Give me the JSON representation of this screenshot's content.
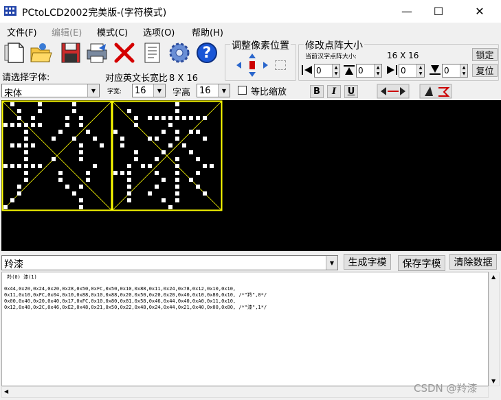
{
  "window": {
    "title": "PCtoLCD2002完美版-(字符模式)",
    "minimize_glyph": "—",
    "maximize_glyph": "☐",
    "close_glyph": "✕"
  },
  "menu": {
    "items": [
      {
        "label": "文件(F)"
      },
      {
        "label": "编辑(E)"
      },
      {
        "label": "模式(C)"
      },
      {
        "label": "选项(O)"
      },
      {
        "label": "帮助(H)"
      }
    ]
  },
  "toolbar": {
    "icons": [
      "new-icon",
      "open-icon",
      "save-icon",
      "print-icon",
      "delete-icon",
      "notes-icon",
      "settings-gear-icon",
      "help-icon"
    ],
    "help_glyph": "?"
  },
  "font_panel": {
    "choose_font_label": "请选择字体:",
    "font_value": "宋体",
    "ratio_label": "对应英文长宽比",
    "ratio_value": "8 X 16",
    "width_label": "字宽:",
    "width_value": "16",
    "height_label": "字高",
    "height_value": "16",
    "keep_ratio_label": "等比缩放",
    "bold_label": "B",
    "italic_label": "I",
    "underline_label": "U"
  },
  "adjust_group": {
    "title": "调整像素位置"
  },
  "matrix_group": {
    "title": "修改点阵大小",
    "current_label": "当前汉字点阵大小:",
    "current_value": "16 X 16",
    "lock_label": "锁定",
    "reset_label": "复位",
    "spinners": [
      "0",
      "0",
      "0",
      "0"
    ]
  },
  "input_row": {
    "text_value": "羚漆",
    "generate_label": "生成字模",
    "save_label": "保存字模",
    "clear_label": "清除数据"
  },
  "output": {
    "header": " 羚(0) 漆(1)",
    "lines": [
      "0x44,0x20,0x24,0x20,0x28,0x50,0xFC,0x50,0x10,0x88,0x11,0x24,0x78,0x12,0x10,0x10,",
      "0x11,0x10,0xFC,0x04,0x10,0x88,0x10,0x88,0x20,0x50,0x20,0x20,0x40,0x10,0x80,0x10, /*\"羚\",0*/",
      "0x00,0x40,0x20,0x40,0x17,0xFC,0x10,0x80,0x81,0x58,0x46,0x44,0x40,0xA0,0x11,0x10,",
      "0x12,0x48,0x2C,0x46,0xE2,0x48,0x21,0x50,0x22,0x48,0x24,0x44,0x21,0x40,0x00,0x80, /*\"漆\",1*/"
    ]
  },
  "watermark": "CSDN @羚漆",
  "glyphs": [
    {
      "name": "ling",
      "bytes": [
        68,
        32,
        36,
        32,
        40,
        80,
        252,
        80,
        16,
        136,
        17,
        36,
        120,
        18,
        16,
        16,
        17,
        16,
        252,
        4,
        16,
        136,
        16,
        136,
        32,
        80,
        32,
        32,
        64,
        16,
        128,
        16
      ]
    },
    {
      "name": "qi",
      "bytes": [
        0,
        64,
        32,
        64,
        23,
        252,
        16,
        128,
        129,
        88,
        70,
        68,
        64,
        160,
        17,
        16,
        18,
        72,
        44,
        70,
        226,
        72,
        33,
        80,
        34,
        72,
        36,
        68,
        33,
        64,
        0,
        128
      ]
    }
  ],
  "colors": {
    "canvas_bg": "#000000",
    "grid_border": "#ffff00",
    "pixel": "#ffffff",
    "help_blue": "#1a56d6",
    "delete_red": "#d40000"
  }
}
